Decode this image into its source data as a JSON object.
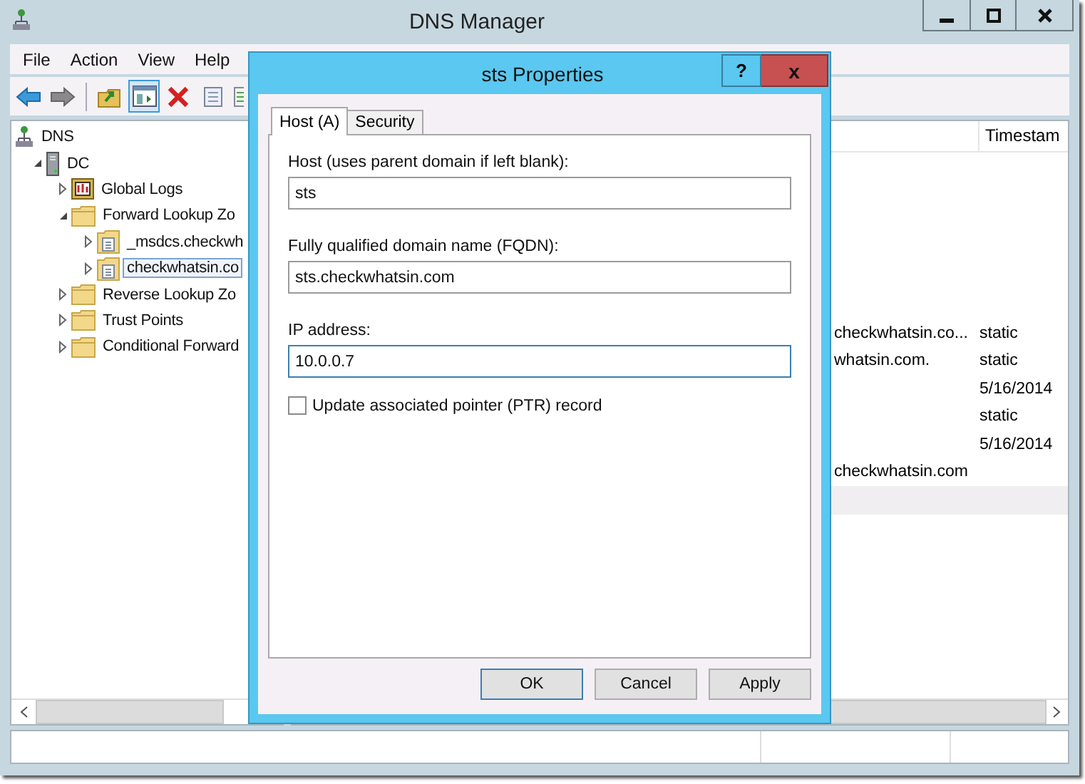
{
  "window": {
    "title": "DNS Manager"
  },
  "menu": [
    "File",
    "Action",
    "View",
    "Help"
  ],
  "toolbar": [
    {
      "kind": "back",
      "pressed": false
    },
    {
      "kind": "forward",
      "pressed": false
    },
    {
      "kind": "up-folder",
      "pressed": false
    },
    {
      "kind": "console-tree",
      "pressed": true
    },
    {
      "kind": "delete",
      "pressed": false
    },
    {
      "kind": "properties",
      "pressed": false
    },
    {
      "kind": "export",
      "pressed": false
    }
  ],
  "tree": [
    {
      "label": "DNS",
      "kind": "dns",
      "selected": false,
      "children": [
        {
          "label": "DC",
          "kind": "server",
          "expanded": true,
          "selected": false,
          "children": [
            {
              "label": "Global Logs",
              "kind": "log",
              "expanded": false,
              "selected": false
            },
            {
              "label": "Forward Lookup Zo",
              "kind": "folder",
              "expanded": true,
              "selected": false,
              "children": [
                {
                  "label": "_msdcs.checkwh",
                  "kind": "zone",
                  "expanded": false,
                  "selected": false
                },
                {
                  "label": "checkwhatsin.co",
                  "kind": "zone",
                  "expanded": false,
                  "selected": true
                }
              ]
            },
            {
              "label": "Reverse Lookup Zo",
              "kind": "folder",
              "expanded": false,
              "selected": false
            },
            {
              "label": "Trust Points",
              "kind": "folder",
              "expanded": false,
              "selected": false
            },
            {
              "label": "Conditional Forward",
              "kind": "folder",
              "expanded": false,
              "selected": false
            }
          ]
        }
      ]
    }
  ],
  "list": {
    "header": "Timestam",
    "rows": [
      {
        "data": "checkwhatsin.co...",
        "timestamp": "static",
        "selected": false
      },
      {
        "data": "whatsin.com.",
        "timestamp": "static",
        "selected": false
      },
      {
        "timestamp": "5/16/2014",
        "selected": false
      },
      {
        "timestamp": "static",
        "selected": false
      },
      {
        "timestamp": "5/16/2014",
        "selected": false
      },
      {
        "data": "checkwhatsin.com",
        "selected": false
      },
      {
        "selected": true
      }
    ]
  },
  "dialog": {
    "title": "sts Properties",
    "help": "?",
    "close": "x",
    "tabs": [
      {
        "label": "Host (A)",
        "selected": true
      },
      {
        "label": "Security",
        "selected": false
      }
    ],
    "fields": [
      {
        "label": "Host (uses parent domain if left blank):",
        "value": "sts",
        "focused": false
      },
      {
        "label": "Fully qualified domain name (FQDN):",
        "value": "sts.checkwhatsin.com",
        "focused": false
      },
      {
        "label": "IP address:",
        "value": "10.0.0.7",
        "focused": true
      }
    ],
    "checkbox": {
      "label": "Update associated pointer (PTR) record",
      "checked": false
    },
    "buttons": [
      {
        "label": "OK",
        "default": true
      },
      {
        "label": "Cancel",
        "default": false
      },
      {
        "label": "Apply",
        "default": false
      }
    ]
  }
}
